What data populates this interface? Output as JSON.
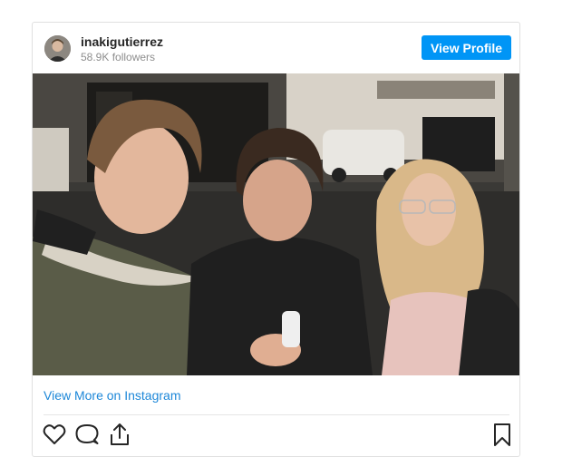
{
  "profile": {
    "username": "inakigutierrez",
    "followers": "58.9K followers",
    "view_profile_label": "View Profile"
  },
  "post": {
    "image_icon": "photo-image",
    "view_more_label": "View More on Instagram"
  },
  "actions": {
    "like_icon": "heart-icon",
    "comment_icon": "comment-icon",
    "share_icon": "share-icon",
    "save_icon": "bookmark-icon"
  },
  "colors": {
    "accent": "#0095f6",
    "link": "#1d87d8"
  }
}
